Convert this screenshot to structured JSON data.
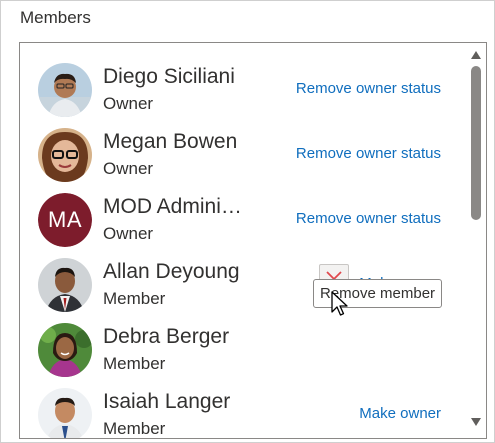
{
  "section": {
    "title": "Members"
  },
  "members": [
    {
      "name": "Diego Siciliani",
      "role": "Owner",
      "action": "Remove owner status",
      "avatar_icon": "diego-avatar"
    },
    {
      "name": "Megan Bowen",
      "role": "Owner",
      "action": "Remove owner status",
      "avatar_icon": "megan-avatar"
    },
    {
      "name": "MOD Administrator",
      "name_display": "MOD Admini…",
      "role": "Owner",
      "action": "Remove owner status",
      "initials": "MA",
      "avatar_color": "#7d1c2c"
    },
    {
      "name": "Allan Deyoung",
      "role": "Member",
      "action": "Make owner",
      "avatar_icon": "allan-avatar"
    },
    {
      "name": "Debra Berger",
      "role": "Member",
      "action": "",
      "avatar_icon": "debra-avatar"
    },
    {
      "name": "Isaiah Langer",
      "role": "Member",
      "action": "Make owner",
      "avatar_icon": "isaiah-avatar"
    }
  ],
  "tooltip": {
    "text": "Remove member"
  },
  "colors": {
    "link": "#106ebe",
    "remove_x": "#e0484d",
    "text": "#323130"
  }
}
